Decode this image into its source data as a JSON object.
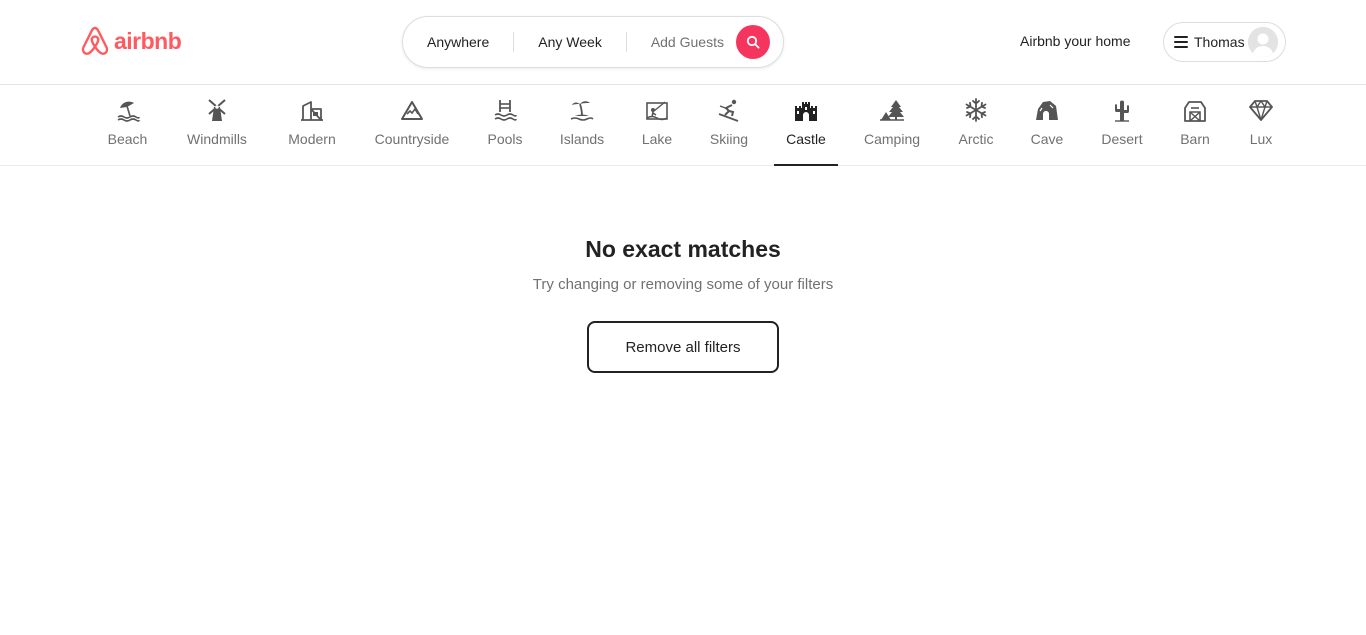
{
  "brand": {
    "name": "airbnb",
    "color": "#ff5a5f"
  },
  "search": {
    "location": "Anywhere",
    "dates": "Any Week",
    "guests": "Add Guests",
    "button_icon": "search-icon",
    "accent": "#f6355f"
  },
  "header": {
    "host_link": "Airbnb your home",
    "user_name": "Thomas",
    "menu_icon": "hamburger-icon",
    "avatar_icon": "avatar-icon"
  },
  "categories": [
    {
      "label": "Beach",
      "icon": "beach-umbrella-icon",
      "active": false
    },
    {
      "label": "Windmills",
      "icon": "windmill-icon",
      "active": false
    },
    {
      "label": "Modern",
      "icon": "modern-house-icon",
      "active": false
    },
    {
      "label": "Countryside",
      "icon": "mountain-icon",
      "active": false
    },
    {
      "label": "Pools",
      "icon": "pool-ladder-icon",
      "active": false
    },
    {
      "label": "Islands",
      "icon": "palm-island-icon",
      "active": false
    },
    {
      "label": "Lake",
      "icon": "lake-fishing-icon",
      "active": false
    },
    {
      "label": "Skiing",
      "icon": "skier-icon",
      "active": false
    },
    {
      "label": "Castle",
      "icon": "castle-icon",
      "active": true
    },
    {
      "label": "Camping",
      "icon": "tent-tree-icon",
      "active": false
    },
    {
      "label": "Arctic",
      "icon": "snowflake-icon",
      "active": false
    },
    {
      "label": "Cave",
      "icon": "cave-icon",
      "active": false
    },
    {
      "label": "Desert",
      "icon": "cactus-icon",
      "active": false
    },
    {
      "label": "Barn",
      "icon": "barn-icon",
      "active": false
    },
    {
      "label": "Lux",
      "icon": "diamond-icon",
      "active": false
    }
  ],
  "empty_state": {
    "title": "No exact matches",
    "subtitle": "Try changing or removing some of your filters",
    "button": "Remove all filters"
  }
}
